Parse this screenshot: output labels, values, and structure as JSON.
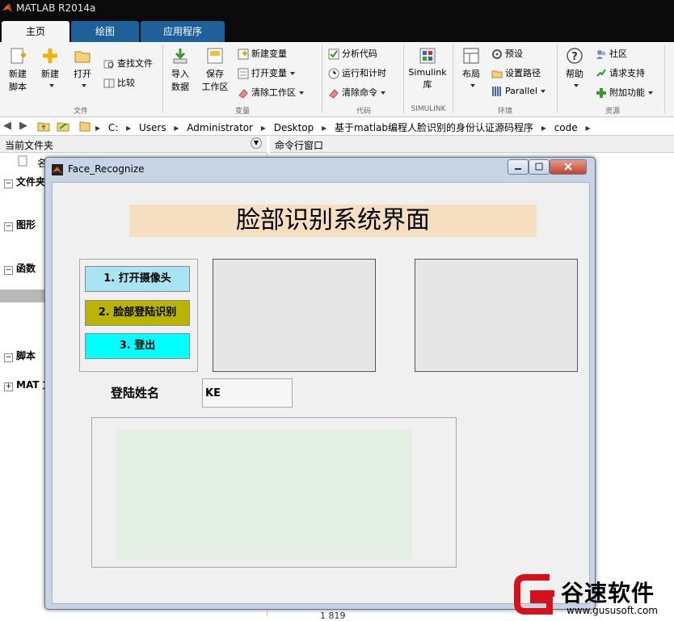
{
  "app": {
    "title": "MATLAB R2014a"
  },
  "tabs": [
    {
      "label": "主页",
      "active": true
    },
    {
      "label": "绘图",
      "active": false
    },
    {
      "label": "应用程序",
      "active": false
    }
  ],
  "ribbon": {
    "file": {
      "new_script": [
        "新建",
        "脚本"
      ],
      "new": "新建",
      "open": "打开",
      "find_files": "查找文件",
      "compare": "比较",
      "group": "文件"
    },
    "variable": {
      "import": [
        "导入",
        "数据"
      ],
      "save_ws": [
        "保存",
        "工作区"
      ],
      "new_var": "新建变量",
      "open_var": "打开变量",
      "clear_ws": "清除工作区",
      "group": "变量"
    },
    "code": {
      "analyze": "分析代码",
      "run_time": "运行和计时",
      "clear_cmd": "清除命令",
      "group": "代码"
    },
    "simulink": {
      "label": [
        "Simulink",
        "库"
      ],
      "group": "SIMULINK"
    },
    "env": {
      "layout": "布局",
      "prefs": "预设",
      "set_path": "设置路径",
      "parallel": "Parallel",
      "group": "环境"
    },
    "resources": {
      "help": "帮助",
      "community": "社区",
      "support": "请求支持",
      "addons": "附加功能",
      "group": "资源"
    }
  },
  "address": {
    "crumbs": [
      "C:",
      "Users",
      "Administrator",
      "Desktop",
      "基于matlab编程人脸识别的身份认证源码程序",
      "code"
    ]
  },
  "panes": {
    "current_folder": "当前文件夹",
    "name_col": "名",
    "command_window": "命令行窗口",
    "tree": [
      {
        "label": "文件夹",
        "sign": "⊟"
      },
      {
        "label": "图形",
        "sign": "⊟"
      },
      {
        "label": "函数",
        "sign": "⊟"
      },
      {
        "label": "脚本",
        "sign": "⊟"
      },
      {
        "label": "MAT 文",
        "sign": "⊞"
      }
    ],
    "cmd_tail": "1    819"
  },
  "figure": {
    "title": "Face_Recognize",
    "heading": "脸部识别系统界面",
    "buttons": [
      {
        "label": "1. 打开摄像头",
        "color": "#a8e4f2"
      },
      {
        "label": "2. 脸部登陆识别",
        "color": "#b8b400"
      },
      {
        "label": "3. 登出",
        "color": "#00ffff"
      }
    ],
    "name_label": "登陆姓名",
    "name_value": "KE"
  },
  "watermark": {
    "brand": "谷速软件",
    "url": "www.gususoft.com"
  }
}
